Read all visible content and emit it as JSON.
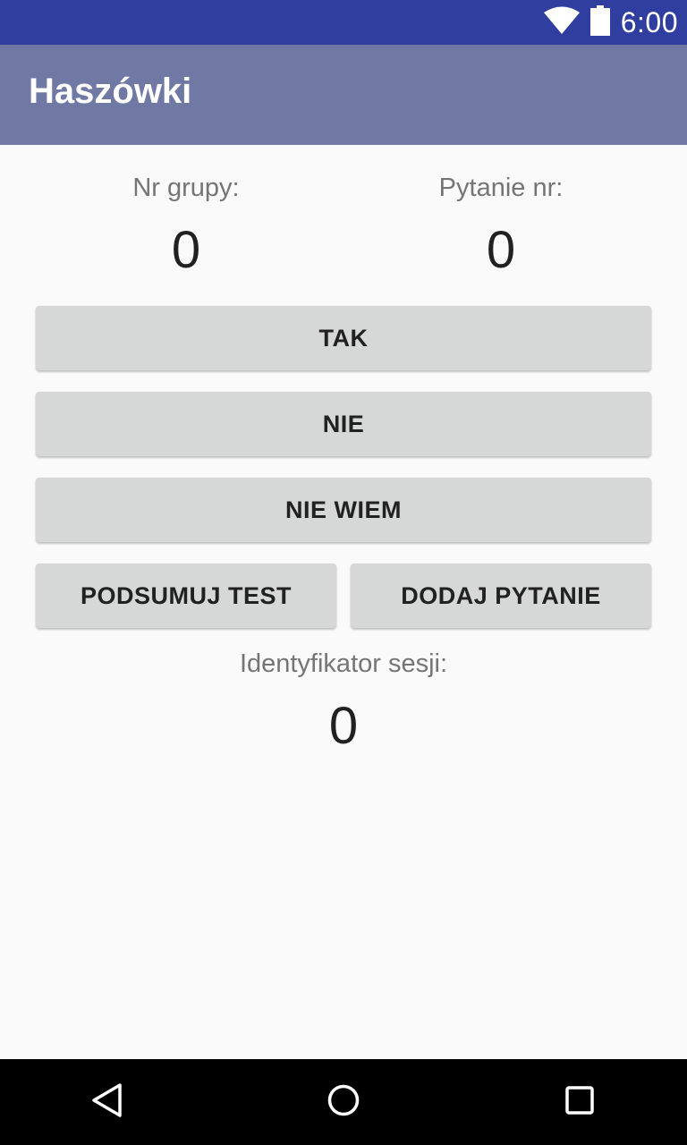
{
  "status_bar": {
    "time": "6:00",
    "icons": [
      "wifi-icon",
      "battery-icon"
    ],
    "background": "#303f9f"
  },
  "app_bar": {
    "title": "Haszówki",
    "background": "#7078a4"
  },
  "main": {
    "group_label": "Nr grupy:",
    "group_value": "0",
    "question_label": "Pytanie nr:",
    "question_value": "0",
    "buttons": {
      "yes": "TAK",
      "no": "NIE",
      "dont_know": "NIE WIEM",
      "summarize": "PODSUMUJ TEST",
      "add_question": "DODAJ PYTANIE"
    },
    "session_label": "Identyfikator sesji:",
    "session_value": "0"
  },
  "nav_bar": {
    "icons": [
      "back-icon",
      "home-icon",
      "recents-icon"
    ]
  }
}
